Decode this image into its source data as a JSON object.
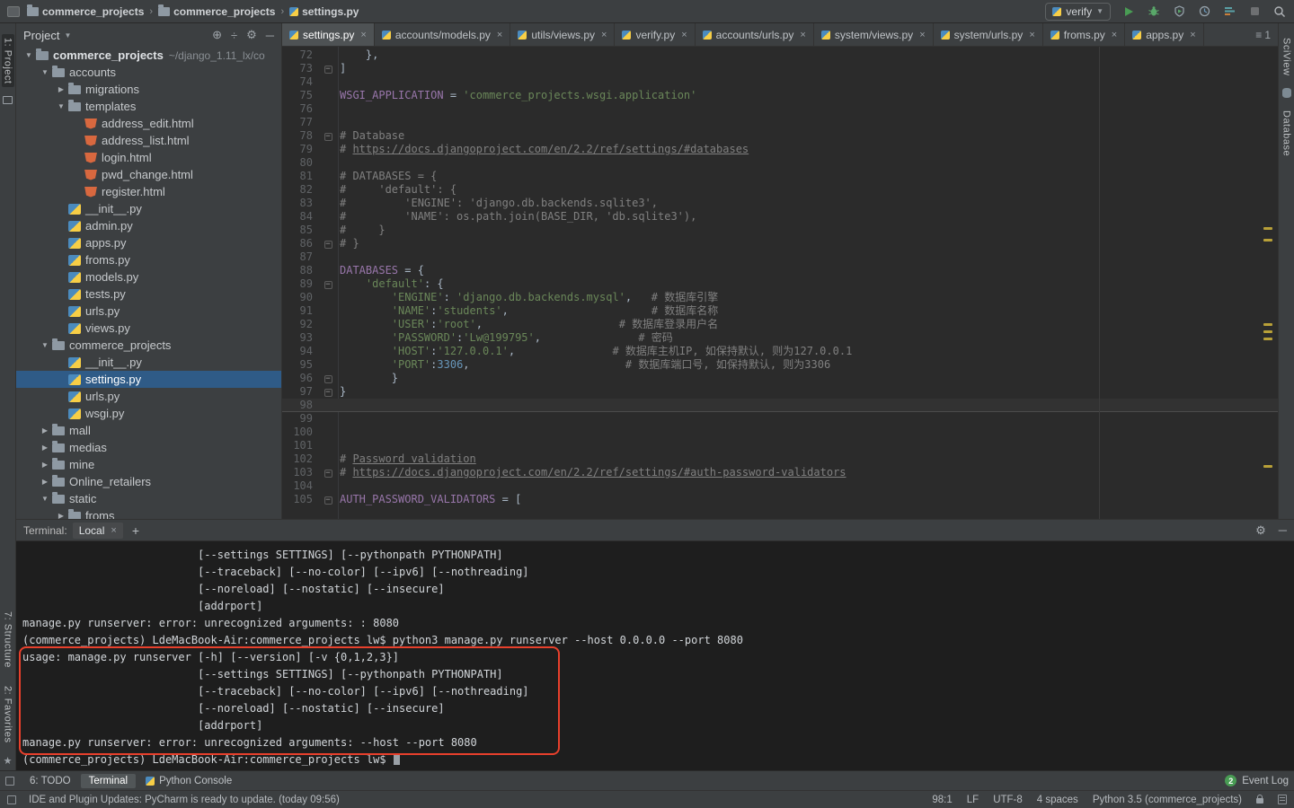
{
  "titlebar": {
    "breadcrumbs": [
      "commerce_projects",
      "commerce_projects",
      "settings.py"
    ],
    "run_config": "verify"
  },
  "stripes": {
    "left_top": "1: Project",
    "left_structure": "7: Structure",
    "left_favorites": "2: Favorites",
    "right_sciview": "SciView",
    "right_database": "Database"
  },
  "project": {
    "header": "Project",
    "items": [
      {
        "depth": 0,
        "arrow": "down",
        "icon": "project",
        "label": "commerce_projects",
        "note": "~/django_1.11_lx/co",
        "bold": true
      },
      {
        "depth": 1,
        "arrow": "down",
        "icon": "folder",
        "label": "accounts"
      },
      {
        "depth": 2,
        "arrow": "right",
        "icon": "folder",
        "label": "migrations"
      },
      {
        "depth": 2,
        "arrow": "down",
        "icon": "folder",
        "label": "templates"
      },
      {
        "depth": 3,
        "icon": "html",
        "label": "address_edit.html"
      },
      {
        "depth": 3,
        "icon": "html",
        "label": "address_list.html"
      },
      {
        "depth": 3,
        "icon": "html",
        "label": "login.html"
      },
      {
        "depth": 3,
        "icon": "html",
        "label": "pwd_change.html"
      },
      {
        "depth": 3,
        "icon": "html",
        "label": "register.html"
      },
      {
        "depth": 2,
        "icon": "py",
        "label": "__init__.py"
      },
      {
        "depth": 2,
        "icon": "py",
        "label": "admin.py"
      },
      {
        "depth": 2,
        "icon": "py",
        "label": "apps.py"
      },
      {
        "depth": 2,
        "icon": "py",
        "label": "froms.py"
      },
      {
        "depth": 2,
        "icon": "py",
        "label": "models.py"
      },
      {
        "depth": 2,
        "icon": "py",
        "label": "tests.py"
      },
      {
        "depth": 2,
        "icon": "py",
        "label": "urls.py"
      },
      {
        "depth": 2,
        "icon": "py",
        "label": "views.py"
      },
      {
        "depth": 1,
        "arrow": "down",
        "icon": "folder",
        "label": "commerce_projects"
      },
      {
        "depth": 2,
        "icon": "py",
        "label": "__init__.py"
      },
      {
        "depth": 2,
        "icon": "py",
        "label": "settings.py",
        "selected": true
      },
      {
        "depth": 2,
        "icon": "py",
        "label": "urls.py"
      },
      {
        "depth": 2,
        "icon": "py",
        "label": "wsgi.py"
      },
      {
        "depth": 1,
        "arrow": "right",
        "icon": "folder",
        "label": "mall"
      },
      {
        "depth": 1,
        "arrow": "right",
        "icon": "folder",
        "label": "medias"
      },
      {
        "depth": 1,
        "arrow": "right",
        "icon": "folder",
        "label": "mine"
      },
      {
        "depth": 1,
        "arrow": "right",
        "icon": "folder",
        "label": "Online_retailers"
      },
      {
        "depth": 1,
        "arrow": "down",
        "icon": "folder",
        "label": "static"
      },
      {
        "depth": 2,
        "arrow": "right",
        "icon": "folder",
        "label": "froms"
      }
    ]
  },
  "editor": {
    "hidden_tabs_count": "1",
    "tabs": [
      {
        "label": "settings.py",
        "active": true
      },
      {
        "label": "accounts/models.py"
      },
      {
        "label": "utils/views.py"
      },
      {
        "label": "verify.py"
      },
      {
        "label": "accounts/urls.py"
      },
      {
        "label": "system/views.py"
      },
      {
        "label": "system/urls.py"
      },
      {
        "label": "froms.py"
      },
      {
        "label": "apps.py"
      }
    ],
    "lines": [
      {
        "num": 72,
        "seg": [
          [
            "    },",
            "p"
          ]
        ]
      },
      {
        "num": 73,
        "fold": true,
        "seg": [
          [
            "]",
            "p"
          ]
        ]
      },
      {
        "num": 74
      },
      {
        "num": 75,
        "seg": [
          [
            "WSGI_APPLICATION",
            "v"
          ],
          [
            " = ",
            "p"
          ],
          [
            "'commerce_projects.wsgi.application'",
            "s"
          ]
        ]
      },
      {
        "num": 76
      },
      {
        "num": 77
      },
      {
        "num": 78,
        "fold": true,
        "seg": [
          [
            "# Database",
            "c"
          ]
        ]
      },
      {
        "num": 79,
        "seg": [
          [
            "# ",
            "c"
          ],
          [
            "https://docs.djangoproject.com/en/2.2/ref/settings/#databases",
            "cl"
          ]
        ]
      },
      {
        "num": 80
      },
      {
        "num": 81,
        "seg": [
          [
            "# DATABASES = {",
            "c"
          ]
        ]
      },
      {
        "num": 82,
        "seg": [
          [
            "#     'default': {",
            "c"
          ]
        ]
      },
      {
        "num": 83,
        "seg": [
          [
            "#         'ENGINE': 'django.db.backends.sqlite3',",
            "c"
          ]
        ]
      },
      {
        "num": 84,
        "seg": [
          [
            "#         'NAME': os.path.join(BASE_DIR, 'db.sqlite3'),",
            "c"
          ]
        ]
      },
      {
        "num": 85,
        "seg": [
          [
            "#     }",
            "c"
          ]
        ]
      },
      {
        "num": 86,
        "fold": true,
        "seg": [
          [
            "# }",
            "c"
          ]
        ]
      },
      {
        "num": 87
      },
      {
        "num": 88,
        "seg": [
          [
            "DATABASES",
            "v"
          ],
          [
            " = {",
            "p"
          ]
        ]
      },
      {
        "num": 89,
        "fold": true,
        "seg": [
          [
            "    ",
            "p"
          ],
          [
            "'default'",
            "s"
          ],
          [
            ": {",
            "p"
          ]
        ]
      },
      {
        "num": 90,
        "seg": [
          [
            "        ",
            "p"
          ],
          [
            "'ENGINE'",
            "s"
          ],
          [
            ": ",
            "p"
          ],
          [
            "'django.db.backends.mysql'",
            "s"
          ],
          [
            ",   ",
            "p"
          ],
          [
            "# 数据库引擎",
            "c"
          ]
        ]
      },
      {
        "num": 91,
        "seg": [
          [
            "        ",
            "p"
          ],
          [
            "'NAME'",
            "s"
          ],
          [
            ":",
            "p"
          ],
          [
            "'students'",
            "s"
          ],
          [
            ",                      ",
            "p"
          ],
          [
            "# 数据库名称",
            "c"
          ]
        ]
      },
      {
        "num": 92,
        "seg": [
          [
            "        ",
            "p"
          ],
          [
            "'USER'",
            "s"
          ],
          [
            ":",
            "p"
          ],
          [
            "'root'",
            "s"
          ],
          [
            ",                     ",
            "p"
          ],
          [
            "# 数据库登录用户名",
            "c"
          ]
        ]
      },
      {
        "num": 93,
        "seg": [
          [
            "        ",
            "p"
          ],
          [
            "'PASSWORD'",
            "s"
          ],
          [
            ":",
            "p"
          ],
          [
            "'Lw@199795'",
            "s"
          ],
          [
            ",               ",
            "p"
          ],
          [
            "# 密码",
            "c"
          ]
        ]
      },
      {
        "num": 94,
        "seg": [
          [
            "        ",
            "p"
          ],
          [
            "'HOST'",
            "s"
          ],
          [
            ":",
            "p"
          ],
          [
            "'127.0.0.1'",
            "s"
          ],
          [
            ",               ",
            "p"
          ],
          [
            "# 数据库主机IP, 如保持默认, 则为127.0.0.1",
            "c"
          ]
        ]
      },
      {
        "num": 95,
        "seg": [
          [
            "        ",
            "p"
          ],
          [
            "'PORT'",
            "s"
          ],
          [
            ":",
            "p"
          ],
          [
            "3306",
            "n"
          ],
          [
            ",                        ",
            "p"
          ],
          [
            "# 数据库端口号, 如保持默认, 则为3306",
            "c"
          ]
        ]
      },
      {
        "num": 96,
        "fold": true,
        "seg": [
          [
            "        }",
            "p"
          ]
        ]
      },
      {
        "num": 97,
        "fold": true,
        "seg": [
          [
            "}",
            "p"
          ]
        ]
      },
      {
        "num": 98,
        "caret": true
      },
      {
        "num": 99
      },
      {
        "num": 100
      },
      {
        "num": 101
      },
      {
        "num": 102,
        "seg": [
          [
            "# ",
            "c"
          ],
          [
            "Password validation",
            "cl"
          ]
        ]
      },
      {
        "num": 103,
        "fold": true,
        "seg": [
          [
            "# ",
            "c"
          ],
          [
            "https://docs.djangoproject.com/en/2.2/ref/settings/#auth-password-validators",
            "cl"
          ]
        ]
      },
      {
        "num": 104
      },
      {
        "num": 105,
        "fold": true,
        "seg": [
          [
            "AUTH_PASSWORD_VALIDATORS",
            "v"
          ],
          [
            " = [",
            "p"
          ]
        ]
      }
    ]
  },
  "terminal": {
    "label": "Terminal:",
    "tab": "Local",
    "lines": [
      "                           [--settings SETTINGS] [--pythonpath PYTHONPATH]",
      "                           [--traceback] [--no-color] [--ipv6] [--nothreading]",
      "                           [--noreload] [--nostatic] [--insecure]",
      "                           [addrport]",
      "manage.py runserver: error: unrecognized arguments: : 8080",
      "(commerce_projects) LdeMacBook-Air:commerce_projects lw$ python3 manage.py runserver --host 0.0.0.0 --port 8080",
      "usage: manage.py runserver [-h] [--version] [-v {0,1,2,3}]",
      "                           [--settings SETTINGS] [--pythonpath PYTHONPATH]",
      "                           [--traceback] [--no-color] [--ipv6] [--nothreading]",
      "                           [--noreload] [--nostatic] [--insecure]",
      "                           [addrport]",
      "manage.py runserver: error: unrecognized arguments: --host --port 8080",
      "(commerce_projects) LdeMacBook-Air:commerce_projects lw$ "
    ]
  },
  "tool_bar": {
    "todo": "6: TODO",
    "terminal": "Terminal",
    "python_console": "Python Console",
    "event_log": "Event Log",
    "event_count": "2"
  },
  "status_bar": {
    "message": "IDE and Plugin Updates: PyCharm is ready to update. (today 09:56)",
    "caret": "98:1",
    "line_ending": "LF",
    "encoding": "UTF-8",
    "indent": "4 spaces",
    "interpreter": "Python 3.5 (commerce_projects)"
  }
}
